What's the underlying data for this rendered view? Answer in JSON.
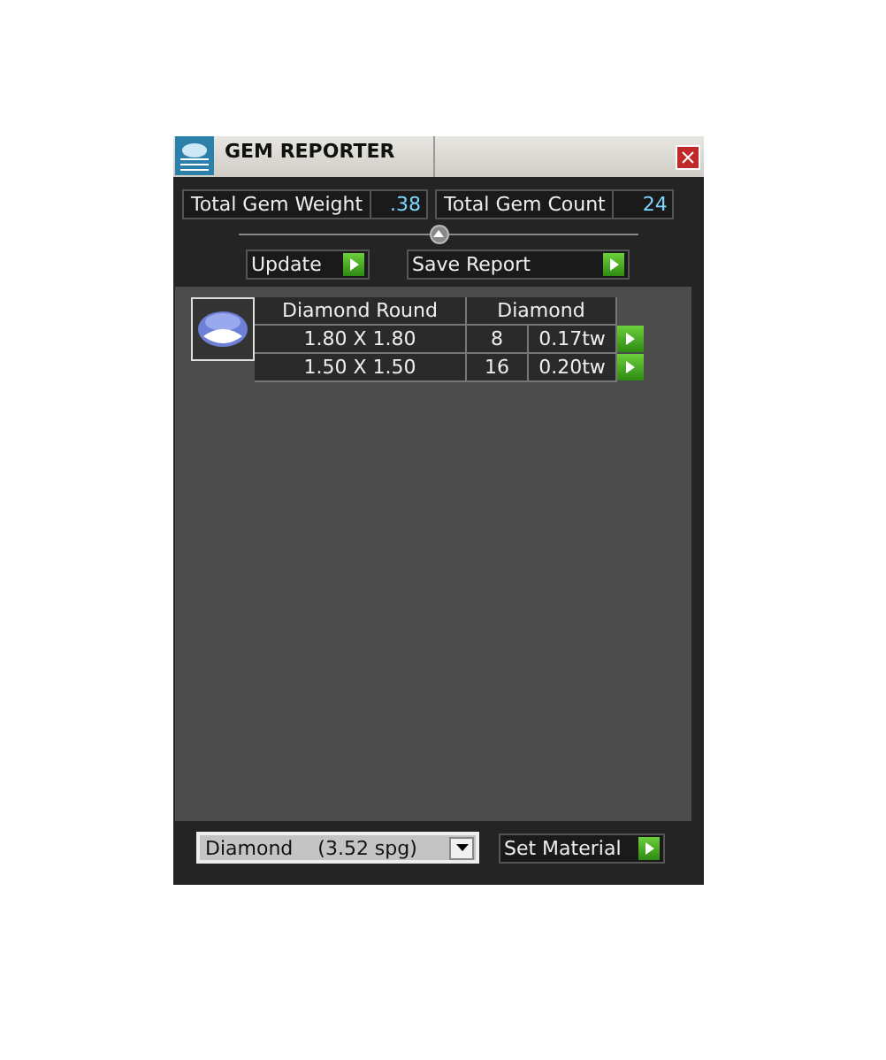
{
  "window": {
    "title": "GEM REPORTER"
  },
  "totals": [
    {
      "label": "Total Gem Weight",
      "value": ".38"
    },
    {
      "label": "Total Gem Count",
      "value": "24"
    }
  ],
  "actions": [
    "Update",
    "Save Report"
  ],
  "gem_group": {
    "shape": "Diamond Round",
    "material": "Diamond",
    "rows": [
      {
        "size": "1.80 X 1.80",
        "count": "8",
        "weight": "0.17tw"
      },
      {
        "size": "1.50 X 1.50",
        "count": "16",
        "weight": "0.20tw"
      }
    ]
  },
  "material_select": {
    "value": "Diamond    (3.52 spg)"
  },
  "set_button": "Set Material"
}
